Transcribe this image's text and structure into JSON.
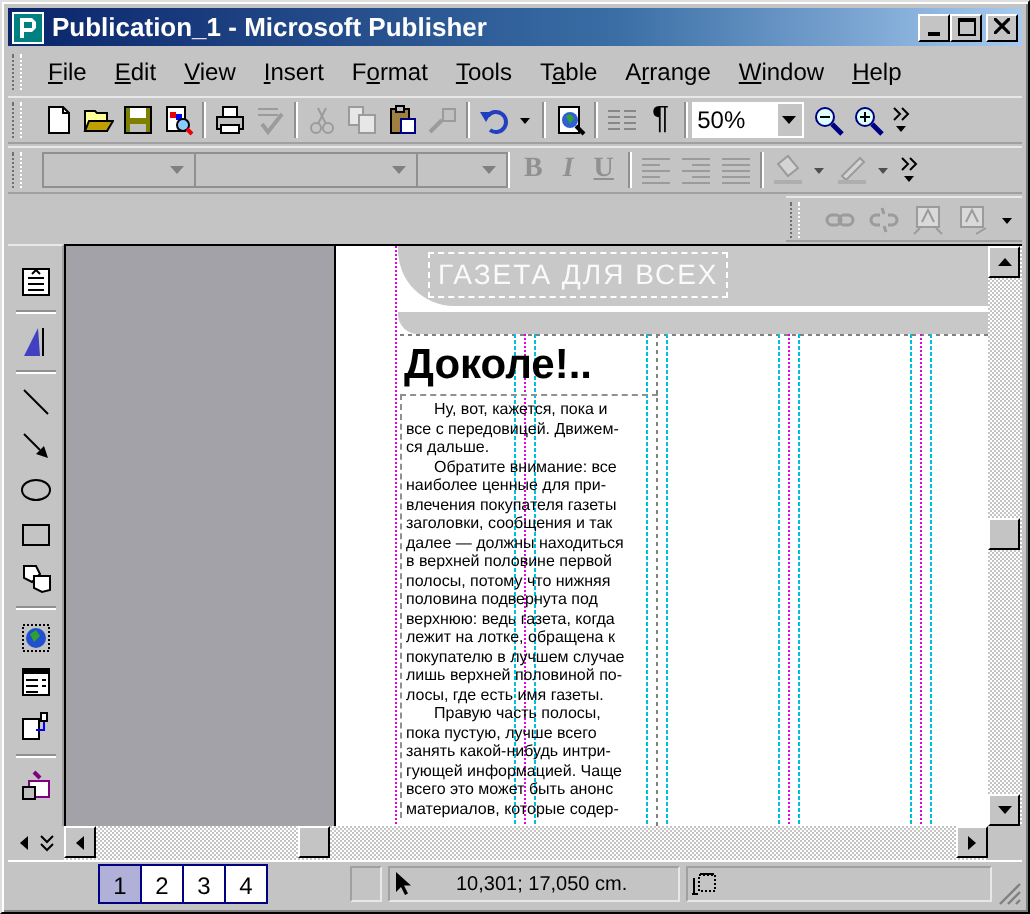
{
  "window": {
    "title": "Publication_1 - Microsoft Publisher"
  },
  "menu": [
    {
      "key": "F",
      "after": "ile"
    },
    {
      "key": "E",
      "after": "dit"
    },
    {
      "key": "V",
      "after": "iew"
    },
    {
      "key": "I",
      "after": "nsert"
    },
    {
      "before": "F",
      "key": "o",
      "after": "rmat"
    },
    {
      "key": "T",
      "after": "ools"
    },
    {
      "before": "T",
      "key": "a",
      "after": "ble"
    },
    {
      "before": "A",
      "key": "r",
      "after": "range"
    },
    {
      "key": "W",
      "after": "indow"
    },
    {
      "key": "H",
      "after": "elp"
    }
  ],
  "standard_toolbar": [
    {
      "kind": "new",
      "disabled": false
    },
    {
      "kind": "open",
      "disabled": false
    },
    {
      "kind": "save",
      "disabled": false
    },
    {
      "kind": "preview",
      "disabled": false
    },
    {
      "kind": "separator"
    },
    {
      "kind": "print",
      "disabled": false
    },
    {
      "kind": "spell",
      "disabled": true
    },
    {
      "kind": "separator"
    },
    {
      "kind": "cut",
      "disabled": true
    },
    {
      "kind": "copy",
      "disabled": true
    },
    {
      "kind": "paste",
      "disabled": false
    },
    {
      "kind": "painter",
      "disabled": true
    },
    {
      "kind": "separator"
    },
    {
      "kind": "undo",
      "disabled": false
    },
    {
      "kind": "dropdown",
      "disabled": false
    },
    {
      "kind": "separator"
    },
    {
      "kind": "webpreview",
      "disabled": false
    },
    {
      "kind": "separator"
    },
    {
      "kind": "columns",
      "disabled": true
    },
    {
      "kind": "pilcrow",
      "label": "¶",
      "disabled": false
    },
    {
      "kind": "separator"
    },
    {
      "kind": "zoom-box",
      "value": "50%"
    },
    {
      "kind": "zoomout",
      "disabled": false
    },
    {
      "kind": "zoomin",
      "disabled": false
    },
    {
      "kind": "more",
      "disabled": false
    }
  ],
  "formatting_toolbar": [
    {
      "kind": "combo",
      "disabled": true
    },
    {
      "kind": "combo",
      "disabled": true
    },
    {
      "kind": "combo",
      "disabled": true
    },
    {
      "kind": "separator"
    },
    {
      "kind": "bold",
      "label": "B",
      "disabled": true
    },
    {
      "kind": "italic",
      "label": "I",
      "disabled": true
    },
    {
      "kind": "underline",
      "label": "U",
      "disabled": true
    },
    {
      "kind": "separator"
    },
    {
      "kind": "alignleft",
      "disabled": true
    },
    {
      "kind": "alignright",
      "disabled": true
    },
    {
      "kind": "justify",
      "disabled": true
    },
    {
      "kind": "separator"
    },
    {
      "kind": "fill",
      "disabled": true
    },
    {
      "kind": "dropdown",
      "disabled": true
    },
    {
      "kind": "linecolor",
      "disabled": true
    },
    {
      "kind": "dropdown",
      "disabled": true
    },
    {
      "kind": "more",
      "disabled": false
    }
  ],
  "connect_toolbar": [
    {
      "kind": "link",
      "disabled": true
    },
    {
      "kind": "unlink",
      "disabled": true
    },
    {
      "kind": "textfwd",
      "disabled": true
    },
    {
      "kind": "textback",
      "disabled": true
    },
    {
      "kind": "dropdown",
      "disabled": false
    }
  ],
  "object_toolbar": [
    {
      "kind": "textframe"
    },
    {
      "kind": "separator"
    },
    {
      "kind": "wordart"
    },
    {
      "kind": "separator"
    },
    {
      "kind": "line"
    },
    {
      "kind": "arrow"
    },
    {
      "kind": "oval"
    },
    {
      "kind": "rect"
    },
    {
      "kind": "shapes"
    },
    {
      "kind": "separator"
    },
    {
      "kind": "clip"
    },
    {
      "kind": "form"
    },
    {
      "kind": "design"
    },
    {
      "kind": "separator"
    },
    {
      "kind": "mail"
    }
  ],
  "page": {
    "banner": "ГАЗЕТА ДЛЯ ВСЕХ",
    "headline": "Доколе!..",
    "paragraphs": [
      [
        "Ну, вот, кажется, пока и",
        "все с передовицей. Движем-",
        "ся дальше."
      ],
      [
        "Обратите внимание: все",
        "наиболее ценные для при-",
        "влечения покупателя газеты",
        "заголовки, сообщения и так",
        "далее — должны находиться",
        "в верхней половине первой",
        "полосы, потому что нижняя",
        "половина подвернута под",
        "верхнюю: ведь газета, когда",
        "лежит на лотке, обращена к",
        "покупателю в лучшем случае",
        "лишь верхней половиной по-",
        "лосы, где есть имя газеты."
      ],
      [
        "Правую часть полосы,",
        "пока пустую, лучше всего",
        "занять какой-нибудь интри-",
        "гующей информацией. Чаще",
        "всего это может быть анонс",
        "материалов, которые содер-"
      ]
    ]
  },
  "pages": [
    {
      "label": "1",
      "selected": true
    },
    {
      "label": "2",
      "selected": false
    },
    {
      "label": "3",
      "selected": false
    },
    {
      "label": "4",
      "selected": false
    }
  ],
  "status": {
    "position": "10,301; 17,050 cm."
  }
}
